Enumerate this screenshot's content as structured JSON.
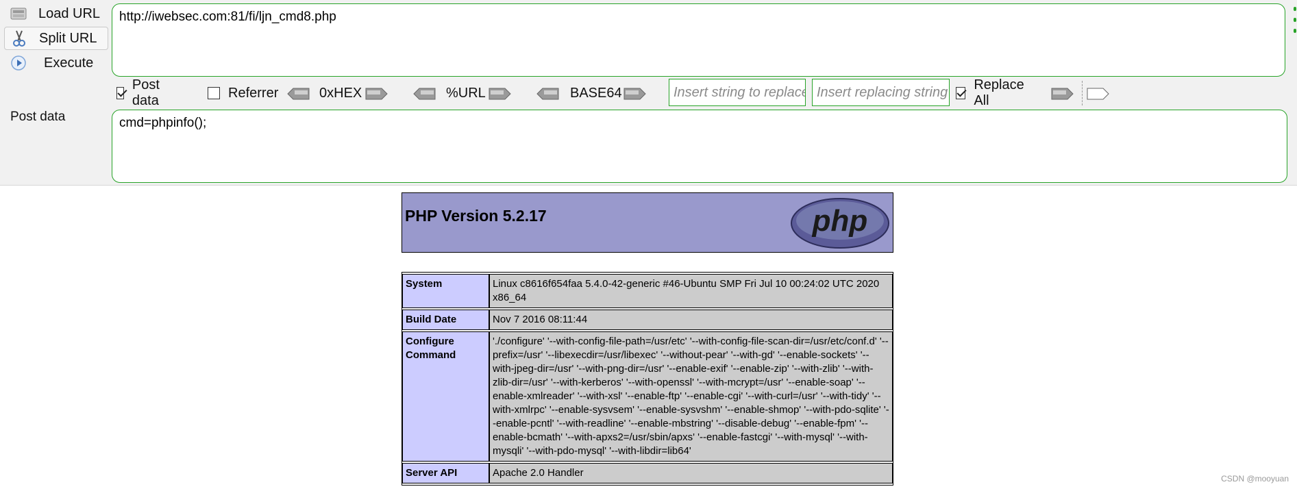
{
  "hackbar": {
    "buttons": {
      "load": "Load URL",
      "split": "Split URL",
      "execute": "Execute"
    },
    "url": "http://iwebsec.com:81/fi/ljn_cmd8.php",
    "post_data_label": "Post data",
    "post_body": "cmd=phpinfo();",
    "toolbar": {
      "post_data": "Post data",
      "post_data_checked": true,
      "referrer": "Referrer",
      "referrer_checked": false,
      "hex": "0xHEX",
      "url_enc": "%URL",
      "base64": "BASE64",
      "replace_placeholder": "Insert string to replace",
      "replacing_placeholder": "Insert replacing string",
      "replace_all": "Replace All",
      "replace_all_checked": true
    }
  },
  "phpinfo": {
    "title": "PHP Version 5.2.17",
    "logo": "php",
    "rows": [
      {
        "key": "System",
        "value": "Linux c8616f654faa 5.4.0-42-generic #46-Ubuntu SMP Fri Jul 10 00:24:02 UTC 2020 x86_64"
      },
      {
        "key": "Build Date",
        "value": "Nov 7 2016 08:11:44"
      },
      {
        "key": "Configure Command",
        "value": "'./configure' '--with-config-file-path=/usr/etc' '--with-config-file-scan-dir=/usr/etc/conf.d' '--prefix=/usr' '--libexecdir=/usr/libexec' '--without-pear' '--with-gd' '--enable-sockets' '--with-jpeg-dir=/usr' '--with-png-dir=/usr' '--enable-exif' '--enable-zip' '--with-zlib' '--with-zlib-dir=/usr' '--with-kerberos' '--with-openssl' '--with-mcrypt=/usr' '--enable-soap' '--enable-xmlreader' '--with-xsl' '--enable-ftp' '--enable-cgi' '--with-curl=/usr' '--with-tidy' '--with-xmlrpc' '--enable-sysvsem' '--enable-sysvshm' '--enable-shmop' '--with-pdo-sqlite' '--enable-pcntl' '--with-readline' '--enable-mbstring' '--disable-debug' '--enable-fpm' '--enable-bcmath' '--with-apxs2=/usr/sbin/apxs' '--enable-fastcgi' '--with-mysql' '--with-mysqli' '--with-pdo-mysql' '--with-libdir=lib64'"
      },
      {
        "key": "Server API",
        "value": "Apache 2.0 Handler"
      }
    ]
  },
  "watermark": "CSDN @mooyuan",
  "colors": {
    "accent_green": "#27a327",
    "php_header": "#9999cc",
    "key_cell": "#ccccff",
    "value_cell": "#cccccc"
  }
}
